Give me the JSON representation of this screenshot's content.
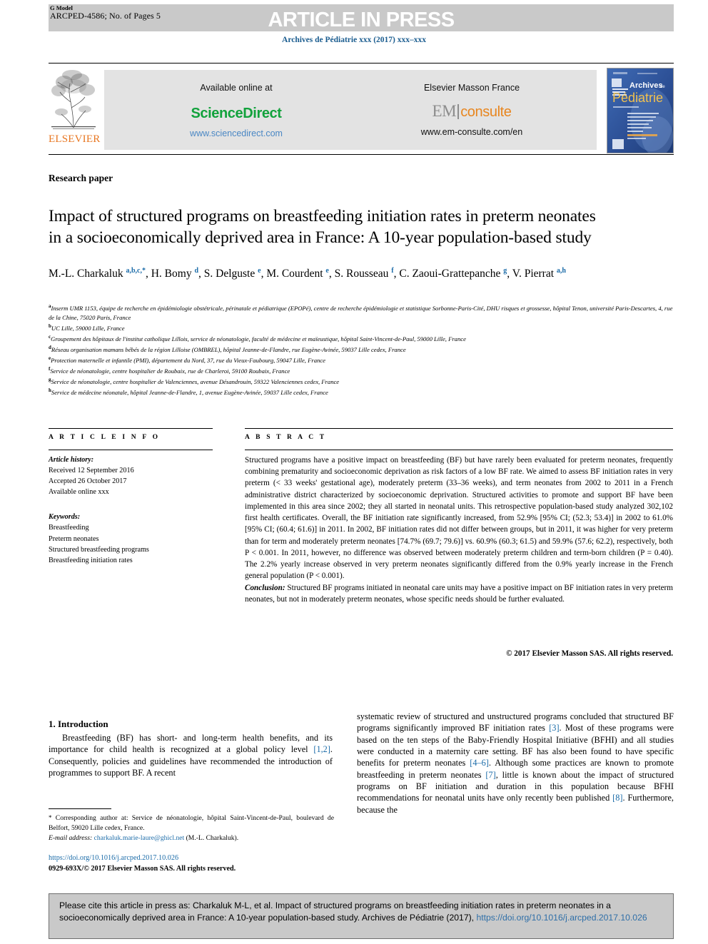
{
  "header": {
    "g_model_label": "G Model",
    "manuscript_id": "ARCPED-4586; No. of Pages 5",
    "press_banner": "ARTICLE IN PRESS",
    "journal_line": "Archives de Pédiatrie xxx (2017) xxx–xxx"
  },
  "masthead": {
    "elsevier_wordmark": "ELSEVIER",
    "available_online_label": "Available online at",
    "sciencedirect_logo": "ScienceDirect",
    "sciencedirect_url": "www.sciencedirect.com",
    "publisher_label": "Elsevier Masson France",
    "em_logo_em": "EM",
    "em_logo_consulte": "consulte",
    "em_url": "www.em-consulte.com/en",
    "cover_title_line1": "Archives de",
    "cover_title_line2": "Pédiatrie"
  },
  "article": {
    "type": "Research paper",
    "title": "Impact of structured programs on breastfeeding initiation rates in preterm neonates in a socioeconomically deprived area in France: A 10-year population-based study",
    "authors_html": "M.-L. Charkaluk <sup>a,b,c,*</sup>, H. Bomy <sup>d</sup>, S. Delguste <sup>e</sup>, M. Courdent <sup>e</sup>, S. Rousseau <sup>f</sup>, C. Zaoui-Grattepanche <sup>g</sup>, V. Pierrat <sup>a,h</sup>",
    "affiliations": [
      {
        "marker": "a",
        "text": "Inserm UMR 1153, équipe de recherche en épidémiologie obstétricale, périnatale et pédiatrique (EPOPé), centre de recherche épidémiologie et statistique Sorbonne-Paris-Cité, DHU risques et grossesse, hôpital Tenon, université Paris-Descartes, 4, rue de la Chine, 75020 Paris, France"
      },
      {
        "marker": "b",
        "text": "UC Lille, 59000 Lille, France"
      },
      {
        "marker": "c",
        "text": "Groupement des hôpitaux de l'institut catholique Lillois, service de néonatologie, faculté de médecine et maïeustique, hôpital Saint-Vincent-de-Paul, 59000 Lille, France"
      },
      {
        "marker": "d",
        "text": "Réseau organisation mamans bébés de la région Lilloise (OMBREL), hôpital Jeanne-de-Flandre, rue Eugène-Avinée, 59037 Lille cedex, France"
      },
      {
        "marker": "e",
        "text": "Protection maternelle et infantile (PMI), département du Nord, 37, rue du Vieux-Faubourg, 59047 Lille, France"
      },
      {
        "marker": "f",
        "text": "Service de néonatologie, centre hospitalier de Roubaix, rue de Charleroi, 59100 Roubaix, France"
      },
      {
        "marker": "g",
        "text": "Service de néonatologie, centre hospitalier de Valenciennes, avenue Désandrouin, 59322 Valenciennes cedex, France"
      },
      {
        "marker": "h",
        "text": "Service de médecine néonatale, hôpital Jeanne-de-Flandre, 1, avenue Eugène-Avinée, 59037 Lille cedex, France"
      }
    ]
  },
  "article_info": {
    "heading": "A R T I C L E   I N F O",
    "history_label": "Article history:",
    "received": "Received 12 September 2016",
    "accepted": "Accepted 26 October 2017",
    "available_online": "Available online xxx",
    "keywords_label": "Keywords:",
    "keywords": [
      "Breastfeeding",
      "Preterm neonates",
      "Structured breastfeeding programs",
      "Breastfeeding initiation rates"
    ]
  },
  "abstract": {
    "heading": "A B S T R A C T",
    "body": "Structured programs have a positive impact on breastfeeding (BF) but have rarely been evaluated for preterm neonates, frequently combining prematurity and socioeconomic deprivation as risk factors of a low BF rate. We aimed to assess BF initiation rates in very preterm (< 33 weeks' gestational age), moderately preterm (33–36 weeks), and term neonates from 2002 to 2011 in a French administrative district characterized by socioeconomic deprivation. Structured activities to promote and support BF have been implemented in this area since 2002; they all started in neonatal units. This retrospective population-based study analyzed 302,102 first health certificates. Overall, the BF initiation rate significantly increased, from 52.9% [95% CI; (52.3; 53.4)] in 2002 to 61.0% [95% CI; (60.4; 61.6)] in 2011. In 2002, BF initiation rates did not differ between groups, but in 2011, it was higher for very preterm than for term and moderately preterm neonates [74.7% (69.7; 79.6)] vs. 60.9% (60.3; 61.5) and 59.9% (57.6; 62.2), respectively, both P < 0.001. In 2011, however, no difference was observed between moderately preterm children and term-born children (P = 0.40). The 2.2% yearly increase observed in very preterm neonates significantly differed from the 0.9% yearly increase in the French general population (P < 0.001).",
    "conclusion_label": "Conclusion:",
    "conclusion_text": " Structured BF programs initiated in neonatal care units may have a positive impact on BF initiation rates in very preterm neonates, but not in moderately preterm neonates, whose specific needs should be further evaluated.",
    "copyright": "© 2017 Elsevier Masson SAS. All rights reserved."
  },
  "introduction": {
    "section_number_title": "1. Introduction",
    "left_column_html": "Breastfeeding (BF) has short- and long-term health benefits, and its importance for child health is recognized at a global policy level <span class=\"ref\">[1,2]</span>. Consequently, policies and guidelines have recommended the introduction of programmes to support BF. A recent",
    "right_column_html": "systematic review of structured and unstructured programs concluded that structured BF programs significantly improved BF initiation rates <span class=\"ref\">[3]</span>. Most of these programs were based on the ten steps of the Baby-Friendly Hospital Initiative (BFHI) and all studies were conducted in a maternity care setting. BF has also been found to have specific benefits for preterm neonates <span class=\"ref\">[4–6]</span>. Although some practices are known to promote breastfeeding in preterm neonates <span class=\"ref\">[7]</span>, little is known about the impact of structured programs on BF initiation and duration in this population because BFHI recommendations for neonatal units have only recently been published <span class=\"ref\">[8]</span>. Furthermore, because the"
  },
  "footnotes": {
    "corresponding_marker": "*",
    "corresponding_text": " Corresponding author at: Service de néonatologie, hôpital Saint-Vincent-de-Paul, boulevard de Belfort, 59020 Lille cedex, France.",
    "email_label": "E-mail address:",
    "email": "charkaluk.marie-laure@ghicl.net",
    "email_owner": "(M.-L. Charkaluk).",
    "doi_url": "https://doi.org/10.1016/j.arcped.2017.10.026",
    "issn_line": "0929-693X/© 2017 Elsevier Masson SAS. All rights reserved."
  },
  "cite_box": {
    "text_part1": "Please cite this article in press as: Charkaluk M-L, et al. Impact of structured programs on breastfeeding initiation rates in preterm neonates in a socioeconomically deprived area in France: A 10-year population-based study. Archives de Pédiatrie (2017), ",
    "link": "https://doi.org/10.1016/j.arcped.2017.10.026"
  },
  "colors": {
    "journal_blue": "#1a5c8f",
    "link_blue": "#1a6ba8",
    "sciencedirect_green": "#12a23c",
    "elsevier_orange": "#e87722",
    "em_orange": "#e8861f",
    "band_grey": "#c9c9c9",
    "banner_grey": "#e3e3e3"
  }
}
